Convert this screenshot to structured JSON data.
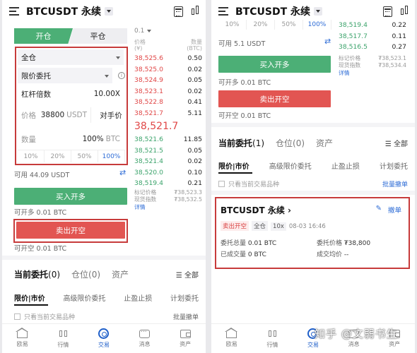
{
  "header": {
    "title": "BTCUSDT 永续"
  },
  "left": {
    "side_tabs": [
      "开仓",
      "平仓"
    ],
    "margin_mode": "全仓",
    "order_type": "限价委托",
    "leverage": {
      "label": "杠杆倍数",
      "value": "10.00X"
    },
    "price": {
      "label": "价格",
      "value": "38800",
      "unit": "USDT",
      "counter": "对手价"
    },
    "qty": {
      "label": "数量",
      "value": "100%",
      "unit": "BTC"
    },
    "percents": [
      "10%",
      "20%",
      "50%",
      "100%"
    ],
    "available": "可用 44.09 USDT",
    "buy_label": "买入开多",
    "can_long": "可开多 0.01 BTC",
    "sell_label": "卖出开空",
    "can_short": "可开空 0.01 BTC"
  },
  "orderbook": {
    "tick": "0.1",
    "head_price": "价格",
    "head_price_unit": "(¥)",
    "head_qty": "数量",
    "head_qty_unit": "(BTC)",
    "asks": [
      [
        "38,525.6",
        "0.50"
      ],
      [
        "38,525.0",
        "0.02"
      ],
      [
        "38,524.9",
        "0.05"
      ],
      [
        "38,523.1",
        "0.02"
      ],
      [
        "38,522.8",
        "0.41"
      ],
      [
        "38,521.7",
        "5.11"
      ]
    ],
    "mid": "38,521.7",
    "bids": [
      [
        "38,521.6",
        "11.85"
      ],
      [
        "38,521.5",
        "0.05"
      ],
      [
        "38,521.4",
        "0.02"
      ],
      [
        "38,520.0",
        "0.10"
      ],
      [
        "38,519.4",
        "0.21"
      ]
    ],
    "mark_label": "标记价格",
    "mark_value": "₮38,523.3",
    "spot_label": "现货指数",
    "spot_value": "₮38,532.5",
    "details": "详情"
  },
  "right_book": {
    "bids": [
      [
        "38,519.4",
        "0.22"
      ],
      [
        "38,517.7",
        "0.11"
      ],
      [
        "38,516.5",
        "0.27"
      ]
    ],
    "mark_value": "₮38,523.1",
    "spot_value": "₮38,534.4",
    "partial_pcts": [
      "10%",
      "20%",
      "50%",
      "100%"
    ],
    "available": "可用 5.1 USDT"
  },
  "orders": {
    "tabs": [
      "当前委托",
      "仓位",
      "资产"
    ],
    "left_counts": [
      "(0)",
      "(0)"
    ],
    "right_counts": [
      "(1)",
      "(0)"
    ],
    "all": "全部",
    "sub_tabs": [
      "限价|市价",
      "高级限价委托",
      "止盈止损",
      "计划委托"
    ],
    "only_current": "只看当前交易品种",
    "cancel_all": "批量撤单"
  },
  "order_card": {
    "symbol": "BTCUSDT 永续",
    "cancel": "撤单",
    "side": "卖出开空",
    "mode": "全仓",
    "lev": "10x",
    "time": "08-03 16:46",
    "total_label": "委托总量",
    "total": "0.01 BTC",
    "price_label": "委托价格",
    "price": "₮38,800",
    "filled_label": "已成交量",
    "filled": "0 BTC",
    "avg_label": "成交均价",
    "avg": "--"
  },
  "nav": [
    "欧易",
    "行情",
    "交易",
    "消息",
    "资产"
  ],
  "watermark": "知乎 @文弱书生",
  "colors": {
    "green": "#4caf76",
    "red": "#e25552",
    "blue": "#2c6bd6"
  }
}
